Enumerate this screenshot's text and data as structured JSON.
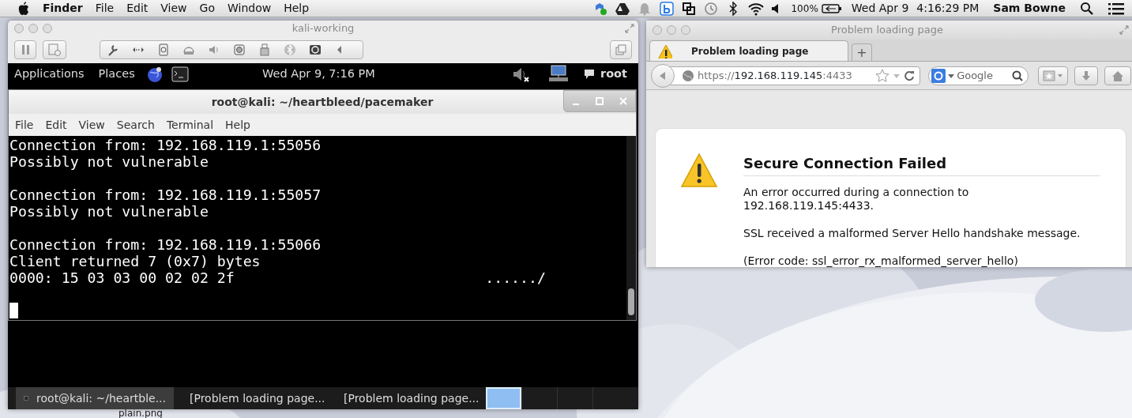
{
  "menubar": {
    "app": "Finder",
    "menus": [
      "File",
      "Edit",
      "View",
      "Go",
      "Window",
      "Help"
    ],
    "battery": "100%",
    "date": "Wed Apr 9",
    "time": "4:16:29 PM",
    "user": "Sam Bowne"
  },
  "vm_window": {
    "title": "kali-working",
    "guest_panel": {
      "menus": [
        "Applications",
        "Places"
      ],
      "clock": "Wed Apr 9, 7:16 PM",
      "user": "root"
    },
    "terminal": {
      "title": "root@kali: ~/heartbleed/pacemaker",
      "menus": [
        "File",
        "Edit",
        "View",
        "Search",
        "Terminal",
        "Help"
      ],
      "blocks": [
        [
          {
            "text": "Connection from: 192.168.119.1:55056"
          },
          {
            "text": "Possibly not vulnerable"
          }
        ],
        [
          {
            "text": "Connection from: 192.168.119.1:55057"
          },
          {
            "text": "Possibly not vulnerable"
          }
        ],
        [
          {
            "text": "Connection from: 192.168.119.1:55066"
          },
          {
            "text": "Client returned 7 (0x7) bytes"
          },
          {
            "text": "0000: 15 03 03 00 02 02 2f",
            "ascii": "....../"
          }
        ]
      ]
    },
    "taskbar": {
      "tasks": [
        {
          "kind": "terminal",
          "label": "root@kali: ~/heartble...",
          "selected": true
        },
        {
          "kind": "browser",
          "label": "[Problem loading page...",
          "selected": false
        },
        {
          "kind": "browser",
          "label": "[Problem loading page...",
          "selected": false
        }
      ],
      "workspaces": [
        {
          "selected": true
        },
        {
          "selected": false
        },
        {
          "selected": false
        },
        {
          "selected": false
        }
      ]
    }
  },
  "browser": {
    "title": "Problem loading page",
    "tabs": [
      {
        "label": "Problem loading page",
        "selected": true
      }
    ],
    "new_tab": "+",
    "url": {
      "scheme": "https://",
      "host": "192.168.119.145",
      "port": ":4433"
    },
    "search": {
      "placeholder": "Google"
    },
    "error": {
      "title": "Secure Connection Failed",
      "paragraphs": [
        "An error occurred during a connection to 192.168.119.145:4433.",
        "SSL received a malformed Server Hello handshake message.",
        "(Error code: ssl_error_rx_malformed_server_hello)"
      ]
    }
  },
  "desktop": {
    "file_label": "plain.png"
  }
}
